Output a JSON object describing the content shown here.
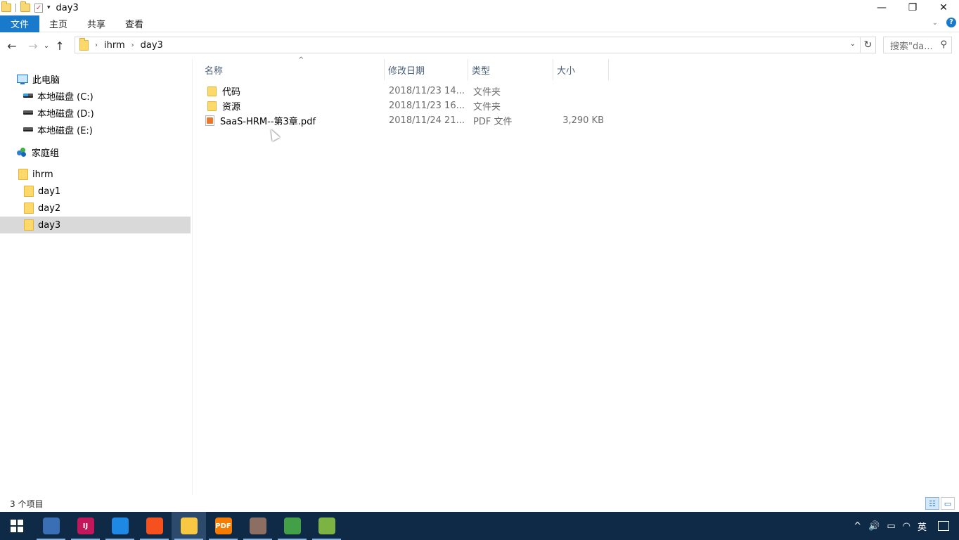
{
  "window": {
    "title": "day3",
    "minimize": "—",
    "restore": "❐",
    "close": "✕"
  },
  "ribbon": {
    "tabs": [
      "文件",
      "主页",
      "共享",
      "查看"
    ],
    "help": "?",
    "expand": "⌄"
  },
  "nav": {
    "back": "←",
    "forward": "→",
    "recent": "⌄",
    "up": "↑"
  },
  "address": {
    "crumbs": [
      "ihrm",
      "day3"
    ],
    "refresh": "↻",
    "search_placeholder": "搜索\"da...",
    "search_icon": "⚲"
  },
  "navpane": {
    "this_pc": "此电脑",
    "drives": [
      "本地磁盘 (C:)",
      "本地磁盘 (D:)",
      "本地磁盘 (E:)"
    ],
    "homegroup": "家庭组",
    "root_folder": "ihrm",
    "subfolders": [
      "day1",
      "day2",
      "day3"
    ],
    "selected": "day3"
  },
  "filelist": {
    "columns": [
      "名称",
      "修改日期",
      "类型",
      "大小"
    ],
    "sort_indicator": "^",
    "rows": [
      {
        "name": "代码",
        "date": "2018/11/23 14...",
        "type": "文件夹",
        "size": "",
        "icon": "folder-icon"
      },
      {
        "name": "资源",
        "date": "2018/11/23 16...",
        "type": "文件夹",
        "size": "",
        "icon": "folder-icon"
      },
      {
        "name": "SaaS-HRM--第3章.pdf",
        "date": "2018/11/24 21...",
        "type": "PDF 文件",
        "size": "3,290 KB",
        "icon": "pdf-file-icon"
      }
    ]
  },
  "statusbar": {
    "item_count": "3 个项目"
  },
  "taskbar": {
    "apps": [
      {
        "name": "dolphin-app-icon",
        "label": "",
        "color": "#3a6fb5",
        "running": true
      },
      {
        "name": "intellij-idea-icon",
        "label": "IJ",
        "color": "#c2185b",
        "running": true
      },
      {
        "name": "vscode-icon",
        "label": "",
        "color": "#1e88e5",
        "running": true
      },
      {
        "name": "feather-app-icon",
        "label": "",
        "color": "#f4511e",
        "running": true
      },
      {
        "name": "file-explorer-icon",
        "label": "",
        "color": "#f8c843",
        "running": true,
        "active": true
      },
      {
        "name": "pdf-reader-icon",
        "label": "PDF",
        "color": "#f57c00",
        "running": true
      },
      {
        "name": "paint-app-icon",
        "label": "",
        "color": "#8d6e63",
        "running": true
      },
      {
        "name": "chrome-icon",
        "label": "",
        "color": "#43a047",
        "running": true
      },
      {
        "name": "notepad-plus-icon",
        "label": "",
        "color": "#7cb342",
        "running": true
      }
    ],
    "tray": {
      "chevron": "^",
      "volume": "🔊",
      "battery": "▭",
      "network": "◠",
      "ime": "英"
    }
  }
}
